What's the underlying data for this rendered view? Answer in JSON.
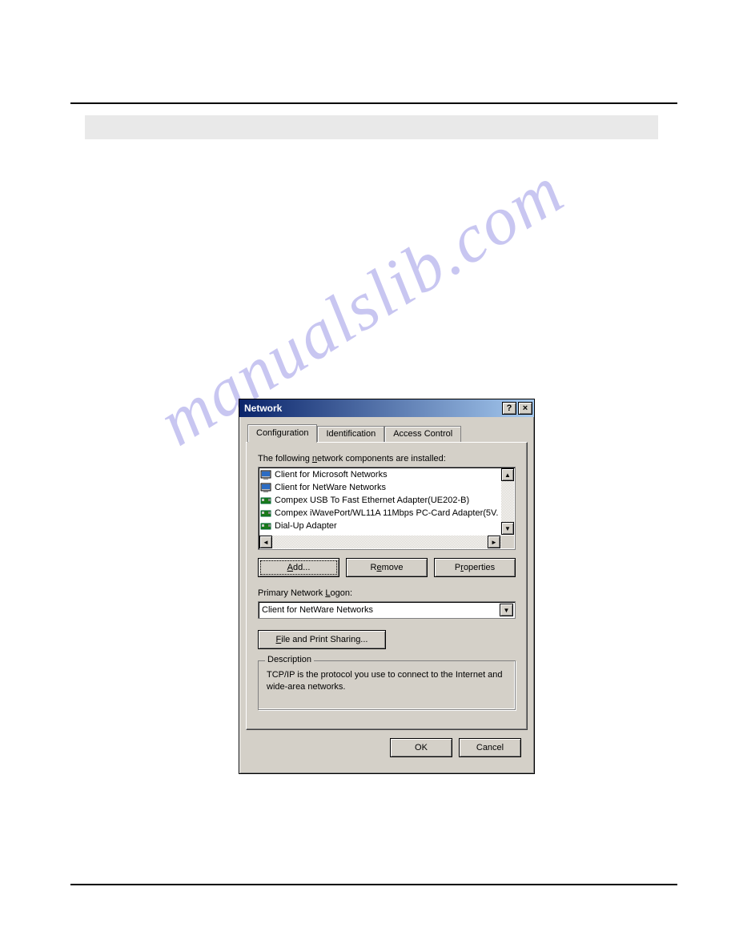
{
  "watermark": "manualslib.com",
  "dialog": {
    "title": "Network",
    "help_aria": "?",
    "close_aria": "×",
    "tabs": {
      "configuration": "Configuration",
      "identification": "Identification",
      "access_control": "Access Control"
    },
    "components_label_pre": "The following ",
    "components_label_underline": "n",
    "components_label_post": "etwork components are installed:",
    "list": [
      {
        "type": "client",
        "text": "Client for Microsoft Networks"
      },
      {
        "type": "client",
        "text": "Client for NetWare Networks"
      },
      {
        "type": "adapter",
        "text": "Compex  USB To Fast Ethernet Adapter(UE202-B)"
      },
      {
        "type": "adapter",
        "text": "Compex iWavePort/WL11A 11Mbps PC-Card Adapter(5V."
      },
      {
        "type": "adapter",
        "text": "Dial-Up Adapter"
      }
    ],
    "buttons": {
      "add_underline": "A",
      "add_rest": "dd...",
      "remove_pre": "R",
      "remove_underline": "e",
      "remove_post": "move",
      "properties_pre": "P",
      "properties_underline": "r",
      "properties_post": "operties"
    },
    "logon_label_pre": "Primary Network ",
    "logon_label_underline": "L",
    "logon_label_post": "ogon:",
    "logon_value": "Client for NetWare Networks",
    "share_btn_underline": "F",
    "share_btn_rest": "ile and Print Sharing...",
    "description_title": "Description",
    "description_text": "TCP/IP is the protocol you use to connect to the Internet and wide-area networks.",
    "ok_label": "OK",
    "cancel_label": "Cancel"
  }
}
